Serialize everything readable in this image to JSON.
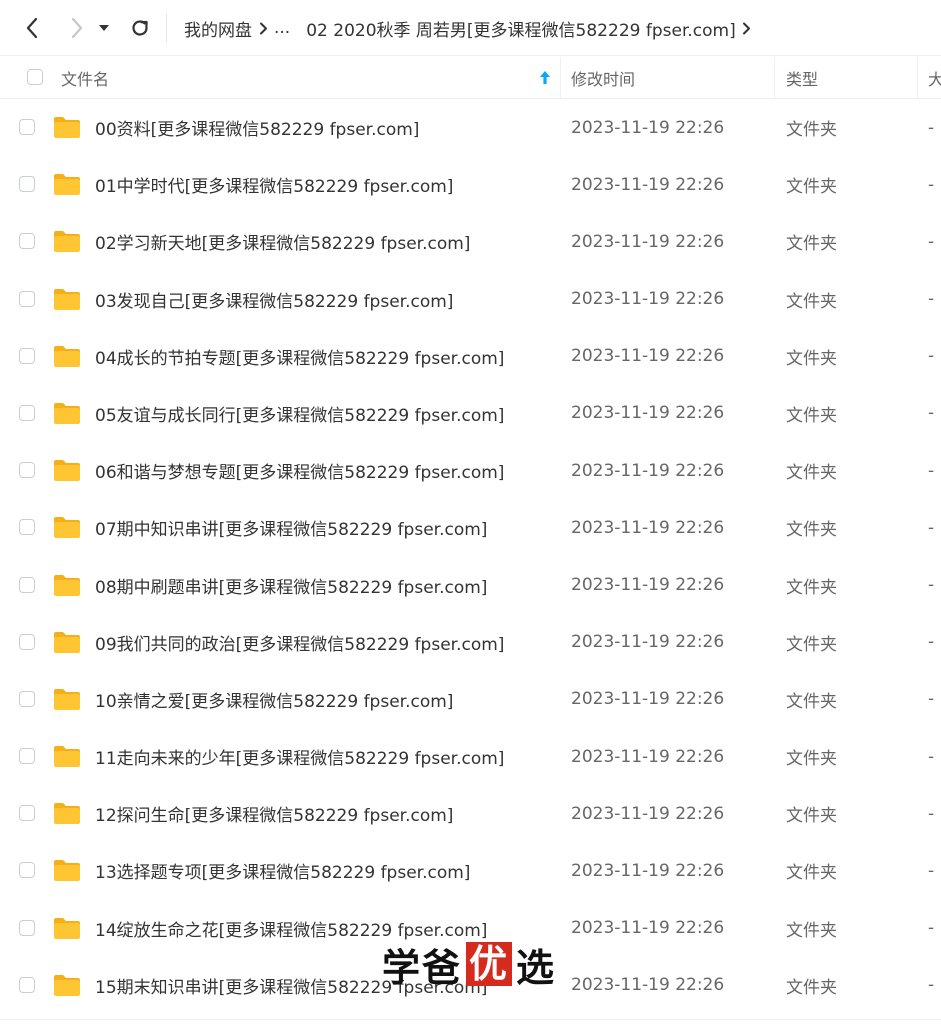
{
  "nav": {
    "breadcrumb": {
      "root": "我的网盘",
      "ellipsis": "...",
      "current": "02 2020秋季 周若男[更多课程微信582229 fpser.com]"
    }
  },
  "table": {
    "columns": {
      "name": "文件名",
      "modified": "修改时间",
      "type": "类型",
      "size": "大"
    },
    "sort": {
      "column": "name",
      "direction": "ascending"
    },
    "rows": [
      {
        "name": "00资料[更多课程微信582229 fpser.com]",
        "modified": "2023-11-19 22:26",
        "type": "文件夹",
        "size": "-"
      },
      {
        "name": "01中学时代[更多课程微信582229 fpser.com]",
        "modified": "2023-11-19 22:26",
        "type": "文件夹",
        "size": "-"
      },
      {
        "name": "02学习新天地[更多课程微信582229 fpser.com]",
        "modified": "2023-11-19 22:26",
        "type": "文件夹",
        "size": "-"
      },
      {
        "name": "03发现自己[更多课程微信582229 fpser.com]",
        "modified": "2023-11-19 22:26",
        "type": "文件夹",
        "size": "-"
      },
      {
        "name": "04成长的节拍专题[更多课程微信582229 fpser.com]",
        "modified": "2023-11-19 22:26",
        "type": "文件夹",
        "size": "-"
      },
      {
        "name": "05友谊与成长同行[更多课程微信582229 fpser.com]",
        "modified": "2023-11-19 22:26",
        "type": "文件夹",
        "size": "-"
      },
      {
        "name": "06和谐与梦想专题[更多课程微信582229 fpser.com]",
        "modified": "2023-11-19 22:26",
        "type": "文件夹",
        "size": "-"
      },
      {
        "name": "07期中知识串讲[更多课程微信582229 fpser.com]",
        "modified": "2023-11-19 22:26",
        "type": "文件夹",
        "size": "-"
      },
      {
        "name": "08期中刷题串讲[更多课程微信582229 fpser.com]",
        "modified": "2023-11-19 22:26",
        "type": "文件夹",
        "size": "-"
      },
      {
        "name": "09我们共同的政治[更多课程微信582229 fpser.com]",
        "modified": "2023-11-19 22:26",
        "type": "文件夹",
        "size": "-"
      },
      {
        "name": "10亲情之爱[更多课程微信582229 fpser.com]",
        "modified": "2023-11-19 22:26",
        "type": "文件夹",
        "size": "-"
      },
      {
        "name": "11走向未来的少年[更多课程微信582229 fpser.com]",
        "modified": "2023-11-19 22:26",
        "type": "文件夹",
        "size": "-"
      },
      {
        "name": "12探问生命[更多课程微信582229 fpser.com]",
        "modified": "2023-11-19 22:26",
        "type": "文件夹",
        "size": "-"
      },
      {
        "name": "13选择题专项[更多课程微信582229 fpser.com]",
        "modified": "2023-11-19 22:26",
        "type": "文件夹",
        "size": "-"
      },
      {
        "name": "14绽放生命之花[更多课程微信582229 fpser.com]",
        "modified": "2023-11-19 22:26",
        "type": "文件夹",
        "size": "-"
      },
      {
        "name": "15期末知识串讲[更多课程微信582229 fpser.com]",
        "modified": "2023-11-19 22:26",
        "type": "文件夹",
        "size": "-"
      }
    ]
  },
  "watermark": {
    "before": "学爸",
    "highlight": "优",
    "after": "选"
  },
  "icons": {
    "back": "back-arrow-icon",
    "forward": "forward-arrow-icon",
    "history": "history-dropdown-icon",
    "refresh": "refresh-icon",
    "separator": "chevron-right-icon",
    "folder": "folder-icon",
    "sort": "sort-ascending-icon"
  },
  "colors": {
    "folder": "#FFC533",
    "folder_dark": "#F5AF19",
    "sort_arrow": "#06A7FF",
    "watermark_highlight": "#D52B1E",
    "text_primary": "#333333",
    "text_secondary": "#666666"
  }
}
